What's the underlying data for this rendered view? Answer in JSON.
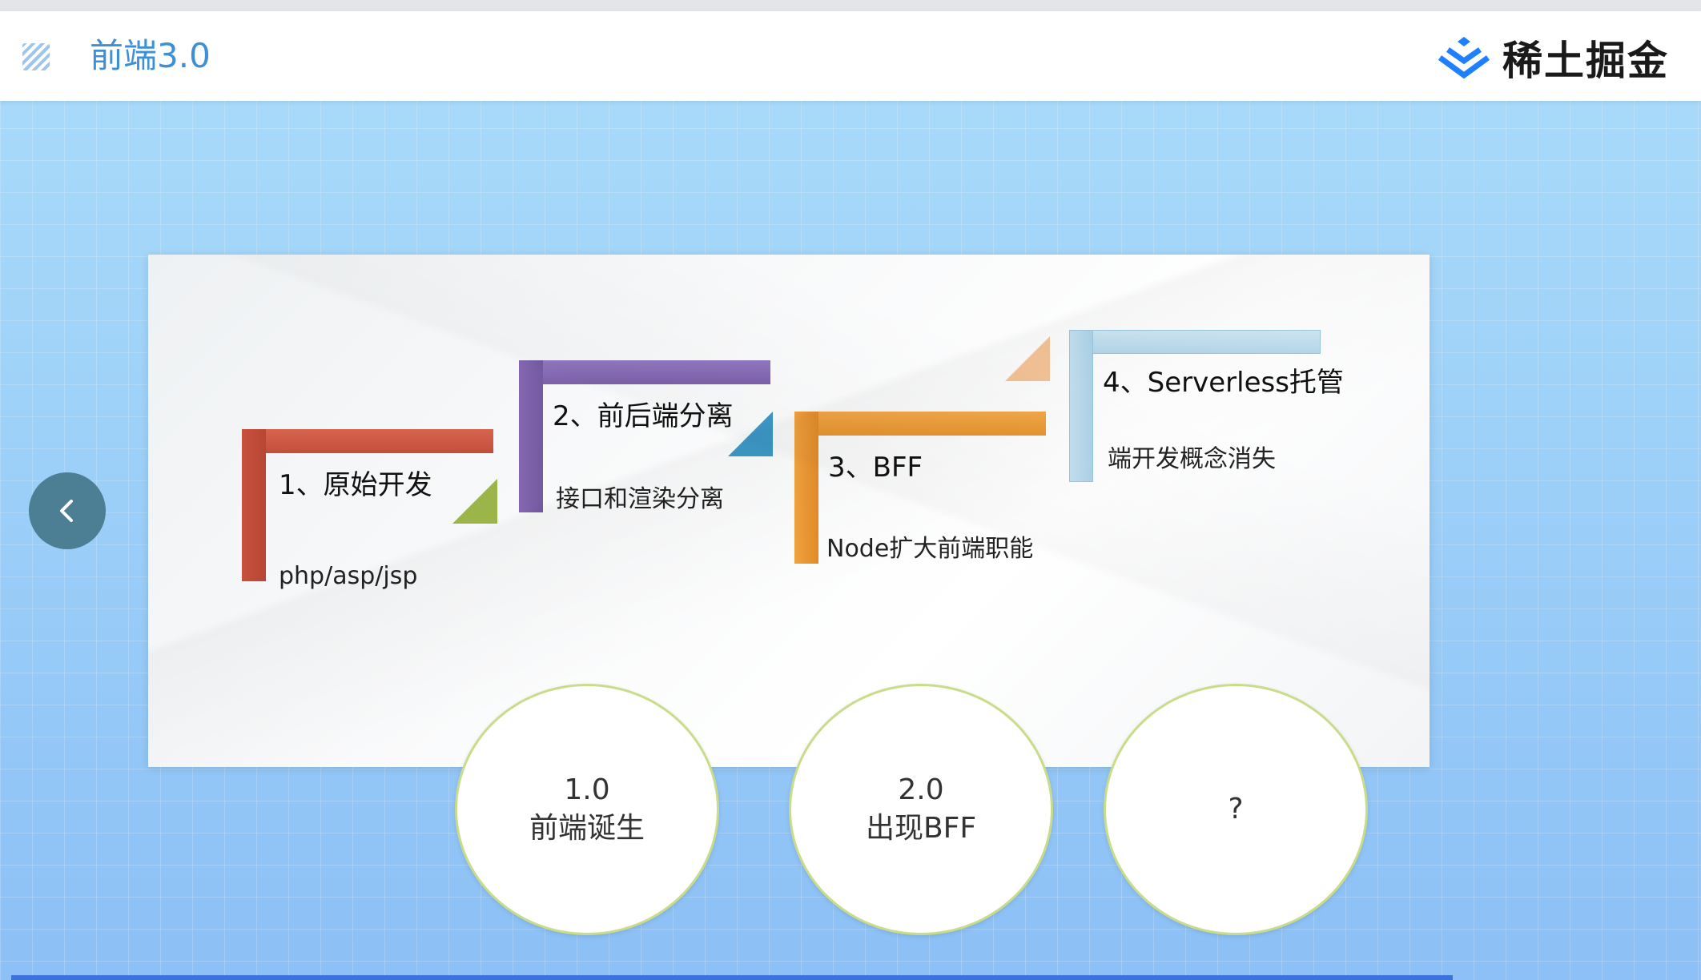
{
  "header": {
    "title": "前端3.0",
    "brand_name": "稀土掘金",
    "menu_icon": "menu-icon",
    "brand_icon": "juejin-logo-icon"
  },
  "steps": [
    {
      "title": "1、原始开发",
      "desc": "php/asp/jsp",
      "color": "#cf5a45"
    },
    {
      "title": "2、前后端分离",
      "desc": "接口和渲染分离",
      "color": "#8a6db5"
    },
    {
      "title": "3、BFF",
      "desc": "Node扩大前端职能",
      "color": "#f0a23f"
    },
    {
      "title": "4、Serverless托管",
      "desc": "端开发概念消失",
      "color": "#b9dbee"
    }
  ],
  "circles": [
    {
      "line1": "1.0",
      "line2": "前端诞生"
    },
    {
      "line1": "2.0",
      "line2": "出现BFF"
    },
    {
      "line1": "?",
      "line2": ""
    }
  ],
  "nav": {
    "prev_icon": "chevron-left-icon"
  },
  "colors": {
    "accent": "#3d8fd8",
    "nav_button": "#4c7f93",
    "triangle_green": "#9bb548",
    "triangle_teal": "#3c98c6",
    "triangle_peach": "#f5c497"
  }
}
